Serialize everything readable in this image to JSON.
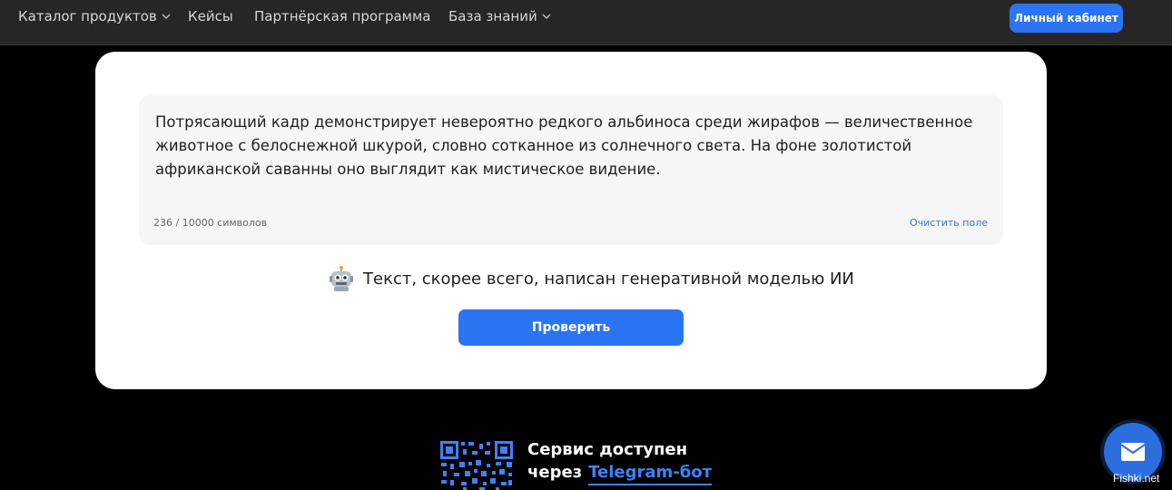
{
  "nav": {
    "items": [
      {
        "label": "Каталог продуктов",
        "has_dropdown": true
      },
      {
        "label": "Кейсы",
        "has_dropdown": false
      },
      {
        "label": "Партнёрская программа",
        "has_dropdown": false
      },
      {
        "label": "База знаний",
        "has_dropdown": true
      }
    ],
    "cabinet_label": "Личный кабинет"
  },
  "checker": {
    "input_text": "Потрясающий кадр демонстрирует невероятно редкого альбиноса среди жирафов — величественное животное с белоснежной шкурой, словно сотканное из солнечного света. На фоне золотистой африканской саванны оно выглядит как мистическое видение.",
    "char_count": "236 / 10000 символов",
    "clear_label": "Очистить поле",
    "result_icon": "robot-icon",
    "result_text": "Текст, скорее всего, написан генеративной моделью ИИ",
    "check_label": "Проверить"
  },
  "promo": {
    "line1": "Сервис доступен",
    "line2_prefix": "через",
    "link_label": "Telegram-бот",
    "qr_icon": "qr-code-icon"
  },
  "mail_icon": "mail-icon",
  "watermark": "Fishki.net",
  "colors": {
    "accent": "#2b74f2",
    "nav_bg": "#262626",
    "page_bg": "#000000",
    "link": "#3d82f7"
  }
}
